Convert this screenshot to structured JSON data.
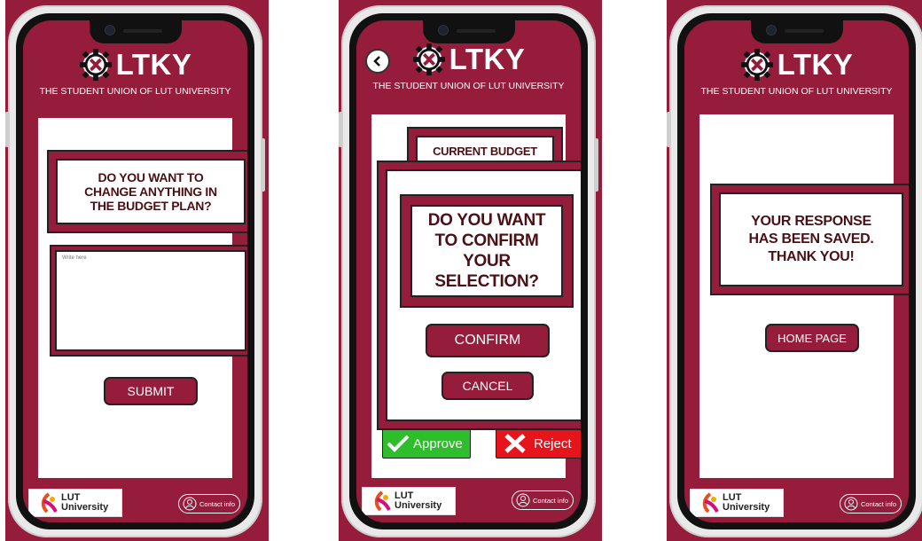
{
  "brand": {
    "logo_text": "LTKY",
    "subtitle": "THE STUDENT UNION OF LUT UNIVERSITY",
    "primary_color": "#951c3b",
    "text_dark": "#4a1016"
  },
  "footer": {
    "lut_line1": "LUT",
    "lut_line2": "University",
    "contact_label": "Contact info"
  },
  "screen1": {
    "question": "DO YOU WANT TO CHANGE ANYTHING IN THE BUDGET PLAN?",
    "input_placeholder": "Write here",
    "submit_label": "SUBMIT"
  },
  "screen2": {
    "background_card_title": "CURRENT BUDGET",
    "question": "DO YOU WANT TO CONFIRM YOUR SELECTION?",
    "confirm_label": "CONFIRM",
    "cancel_label": "CANCEL",
    "approve_label": "Approve",
    "reject_label": "Reject",
    "approve_color": "#2ebd2b",
    "reject_color": "#e8141b"
  },
  "screen3": {
    "message": "YOUR RESPONSE HAS BEEN SAVED. THANK YOU!",
    "home_label": "HOME PAGE"
  }
}
